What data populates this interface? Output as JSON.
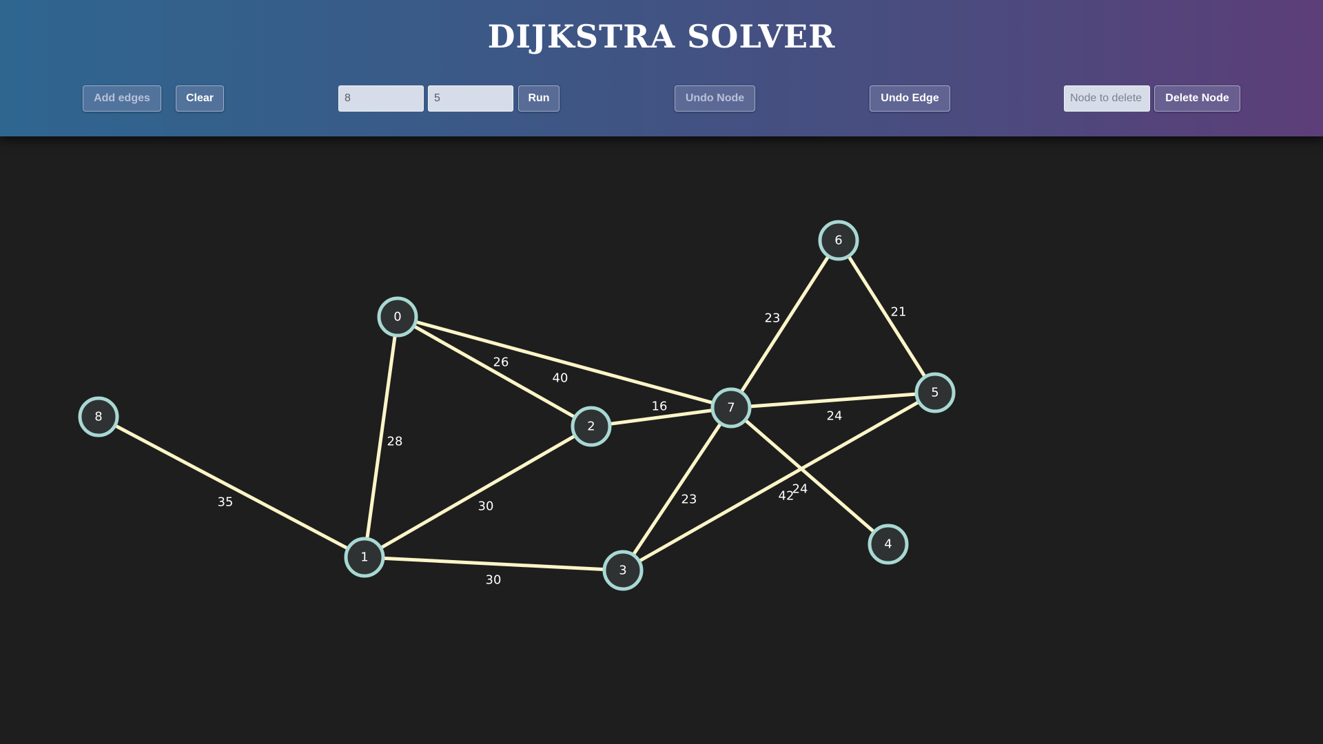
{
  "app": {
    "title": "DIJKSTRA SOLVER"
  },
  "toolbar": {
    "add_edges_label": "Add edges",
    "clear_label": "Clear",
    "source_value": "8",
    "target_value": "5",
    "run_label": "Run",
    "undo_node_label": "Undo Node",
    "undo_edge_label": "Undo Edge",
    "delete_placeholder": "Node to delete",
    "delete_node_label": "Delete Node"
  },
  "colors": {
    "node_fill": "#2f3233",
    "node_stroke": "#a8d8d3",
    "edge": "#fdf5c8",
    "background": "#1e1e1e"
  },
  "graph": {
    "nodes": [
      {
        "id": "0",
        "label": "0"
      },
      {
        "id": "1",
        "label": "1"
      },
      {
        "id": "2",
        "label": "2"
      },
      {
        "id": "3",
        "label": "3"
      },
      {
        "id": "4",
        "label": "4"
      },
      {
        "id": "5",
        "label": "5"
      },
      {
        "id": "6",
        "label": "6"
      },
      {
        "id": "7",
        "label": "7"
      },
      {
        "id": "8",
        "label": "8"
      }
    ],
    "edges": [
      {
        "from": "8",
        "to": "1",
        "weight": "35"
      },
      {
        "from": "0",
        "to": "1",
        "weight": "28"
      },
      {
        "from": "0",
        "to": "2",
        "weight": "26"
      },
      {
        "from": "0",
        "to": "7",
        "weight": "40"
      },
      {
        "from": "1",
        "to": "2",
        "weight": "30"
      },
      {
        "from": "1",
        "to": "3",
        "weight": "30"
      },
      {
        "from": "2",
        "to": "7",
        "weight": "16"
      },
      {
        "from": "7",
        "to": "6",
        "weight": "23"
      },
      {
        "from": "6",
        "to": "5",
        "weight": "21"
      },
      {
        "from": "7",
        "to": "5",
        "weight": "24"
      },
      {
        "from": "7",
        "to": "3",
        "weight": "23"
      },
      {
        "from": "7",
        "to": "4",
        "weight": "24"
      },
      {
        "from": "3",
        "to": "5",
        "weight": "42"
      }
    ]
  }
}
